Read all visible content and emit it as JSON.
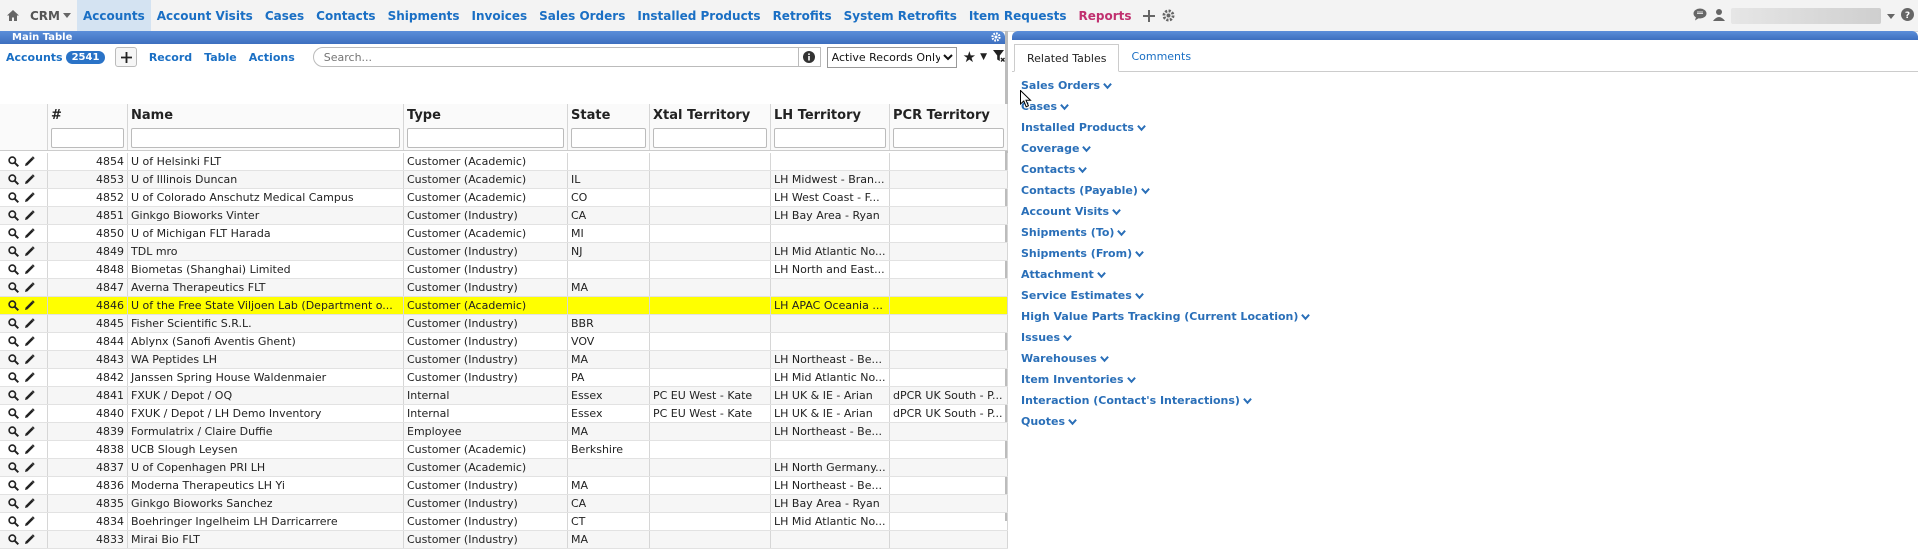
{
  "nav": {
    "app_label": "CRM",
    "items": [
      {
        "label": "Accounts",
        "active": true
      },
      {
        "label": "Account Visits"
      },
      {
        "label": "Cases"
      },
      {
        "label": "Contacts"
      },
      {
        "label": "Shipments"
      },
      {
        "label": "Invoices"
      },
      {
        "label": "Sales Orders"
      },
      {
        "label": "Installed Products"
      },
      {
        "label": "Retrofits"
      },
      {
        "label": "System Retrofits"
      },
      {
        "label": "Item Requests"
      },
      {
        "label": "Reports"
      }
    ]
  },
  "main": {
    "title": "Main Table",
    "accounts_label": "Accounts",
    "count": "2541",
    "record_label": "Record",
    "table_label": "Table",
    "actions_label": "Actions",
    "search_placeholder": "Search...",
    "filter_selected": "Active Records Only",
    "columns": [
      "#",
      "Name",
      "Type",
      "State",
      "Xtal Territory",
      "LH Territory",
      "PCR Territory"
    ],
    "rows": [
      {
        "num": "4854",
        "name": "U of Helsinki FLT",
        "type": "Customer (Academic)",
        "state": "",
        "xtal": "",
        "lh": "",
        "pcr": ""
      },
      {
        "num": "4853",
        "name": "U of Illinois Duncan",
        "type": "Customer (Academic)",
        "state": "IL",
        "xtal": "",
        "lh": "LH Midwest - Bran...",
        "pcr": ""
      },
      {
        "num": "4852",
        "name": "U of Colorado Anschutz Medical Campus",
        "type": "Customer (Academic)",
        "state": "CO",
        "xtal": "",
        "lh": "LH West Coast - F...",
        "pcr": ""
      },
      {
        "num": "4851",
        "name": "Ginkgo Bioworks Vinter",
        "type": "Customer (Industry)",
        "state": "CA",
        "xtal": "",
        "lh": "LH Bay Area - Ryan",
        "pcr": ""
      },
      {
        "num": "4850",
        "name": "U of Michigan FLT Harada",
        "type": "Customer (Academic)",
        "state": "MI",
        "xtal": "",
        "lh": "",
        "pcr": ""
      },
      {
        "num": "4849",
        "name": "TDL mro",
        "type": "Customer (Industry)",
        "state": "NJ",
        "xtal": "",
        "lh": "LH Mid Atlantic No...",
        "pcr": ""
      },
      {
        "num": "4848",
        "name": "Biometas (Shanghai) Limited",
        "type": "Customer (Industry)",
        "state": "",
        "xtal": "",
        "lh": "LH North and East...",
        "pcr": ""
      },
      {
        "num": "4847",
        "name": "Averna Therapeutics FLT",
        "type": "Customer (Industry)",
        "state": "MA",
        "xtal": "",
        "lh": "",
        "pcr": ""
      },
      {
        "num": "4846",
        "name": "U of the Free State Viljoen Lab (Department o...",
        "type": "Customer (Academic)",
        "state": "",
        "xtal": "",
        "lh": "LH APAC Oceania ...",
        "pcr": "",
        "highlight": true
      },
      {
        "num": "4845",
        "name": "Fisher Scientific S.R.L.",
        "type": "Customer (Industry)",
        "state": "BBR",
        "xtal": "",
        "lh": "",
        "pcr": ""
      },
      {
        "num": "4844",
        "name": "Ablynx (Sanofi Aventis Ghent)",
        "type": "Customer (Industry)",
        "state": "VOV",
        "xtal": "",
        "lh": "",
        "pcr": ""
      },
      {
        "num": "4843",
        "name": "WA Peptides LH",
        "type": "Customer (Industry)",
        "state": "MA",
        "xtal": "",
        "lh": "LH Northeast - Be...",
        "pcr": ""
      },
      {
        "num": "4842",
        "name": "Janssen Spring House Waldenmaier",
        "type": "Customer (Industry)",
        "state": "PA",
        "xtal": "",
        "lh": "LH Mid Atlantic No...",
        "pcr": ""
      },
      {
        "num": "4841",
        "name": "FXUK / Depot / OQ",
        "type": "Internal",
        "state": "Essex",
        "xtal": "PC EU West - Kate",
        "lh": "LH UK & IE - Arian",
        "pcr": "dPCR UK South - P..."
      },
      {
        "num": "4840",
        "name": "FXUK / Depot / LH Demo Inventory",
        "type": "Internal",
        "state": "Essex",
        "xtal": "PC EU West - Kate",
        "lh": "LH UK & IE - Arian",
        "pcr": "dPCR UK South - P..."
      },
      {
        "num": "4839",
        "name": "Formulatrix / Claire Duffie",
        "type": "Employee",
        "state": "MA",
        "xtal": "",
        "lh": "LH Northeast - Be...",
        "pcr": ""
      },
      {
        "num": "4838",
        "name": "UCB Slough Leysen",
        "type": "Customer (Academic)",
        "state": "Berkshire",
        "xtal": "",
        "lh": "",
        "pcr": ""
      },
      {
        "num": "4837",
        "name": "U of Copenhagen PRI LH",
        "type": "Customer (Academic)",
        "state": "",
        "xtal": "",
        "lh": "LH North Germany...",
        "pcr": ""
      },
      {
        "num": "4836",
        "name": "Moderna Therapeutics LH Yi",
        "type": "Customer (Industry)",
        "state": "MA",
        "xtal": "",
        "lh": "LH Northeast - Be...",
        "pcr": ""
      },
      {
        "num": "4835",
        "name": "Ginkgo Bioworks Sanchez",
        "type": "Customer (Industry)",
        "state": "CA",
        "xtal": "",
        "lh": "LH Bay Area - Ryan",
        "pcr": ""
      },
      {
        "num": "4834",
        "name": "Boehringer Ingelheim LH Darricarrere",
        "type": "Customer (Industry)",
        "state": "CT",
        "xtal": "",
        "lh": "LH Mid Atlantic No...",
        "pcr": ""
      },
      {
        "num": "4833",
        "name": "Mirai Bio FLT",
        "type": "Customer (Industry)",
        "state": "MA",
        "xtal": "",
        "lh": "",
        "pcr": ""
      }
    ]
  },
  "related": {
    "tab_related": "Related Tables",
    "tab_comments": "Comments",
    "items": [
      "Sales Orders",
      "Cases",
      "Installed Products",
      "Coverage",
      "Contacts",
      "Contacts (Payable)",
      "Account Visits",
      "Shipments (To)",
      "Shipments (From)",
      "Attachment",
      "Service Estimates",
      "High Value Parts Tracking (Current Location)",
      "Issues",
      "Warehouses",
      "Item Inventories",
      "Interaction (Contact's Interactions)",
      "Quotes"
    ]
  },
  "colors": {
    "link": "#1a6fc4",
    "header_blue": "#3d6fbf",
    "highlight": "#ffff00",
    "reports": "#c0306f"
  }
}
